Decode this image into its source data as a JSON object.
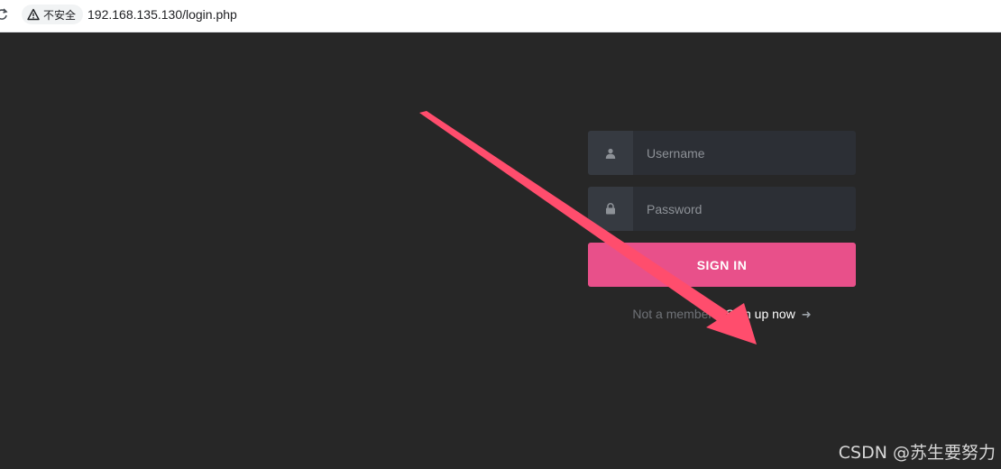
{
  "browser": {
    "security_label": "不安全",
    "url": "192.168.135.130/login.php"
  },
  "login": {
    "username_placeholder": "Username",
    "password_placeholder": "Password",
    "signin_label": "SIGN IN",
    "not_member_text": "Not a member?",
    "signup_link": "Sign up now"
  },
  "colors": {
    "page_bg": "#272727",
    "accent": "#e8508a",
    "annotation_arrow": "#ff4d6d"
  },
  "icons": {
    "username": "user-icon",
    "password": "lock-icon",
    "signup": "arrow-right-icon",
    "security": "warning-triangle-icon"
  },
  "watermark": "CSDN @苏生要努力"
}
